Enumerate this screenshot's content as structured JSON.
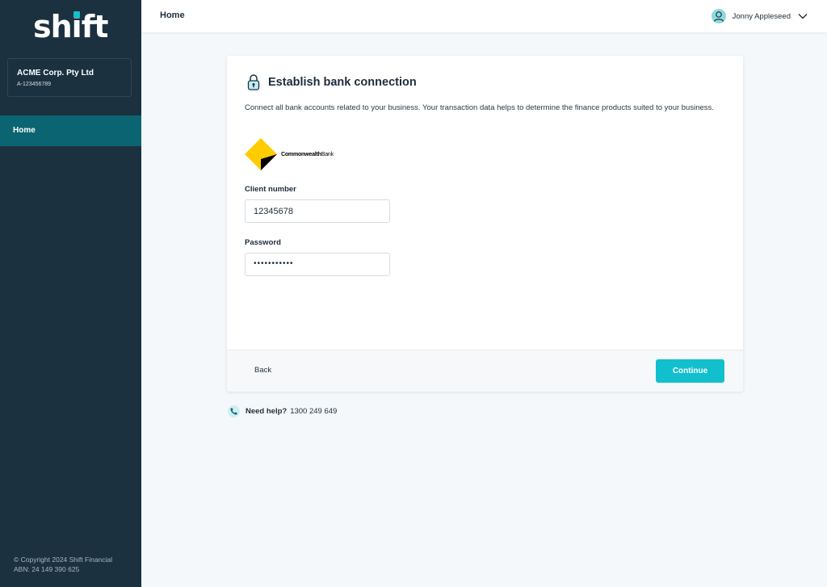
{
  "app": {
    "logo_text_before": "sh",
    "logo_text_i": "i",
    "logo_text_after": "ft",
    "accent_color": "#12bfcd"
  },
  "sidebar": {
    "org_name": "ACME Corp. Pty Ltd",
    "org_id": "A-123456789",
    "nav": [
      {
        "label": "Home",
        "active": true
      }
    ],
    "copyright": "© Copyright 2024 Shift Financial",
    "abn": "ABN: 24 149 390 625"
  },
  "topbar": {
    "title": "Home",
    "user_name": "Jonny Appleseed",
    "user_icon": "user-icon",
    "menu_icon": "chevron-down-icon"
  },
  "card": {
    "icon": "lock-icon",
    "title": "Establish bank connection",
    "description": "Connect all bank accounts related to your business. Your transaction data helps to determine the finance products suited to your business.",
    "bank": {
      "name_bold": "Commonwealth",
      "name_regular": "Bank"
    },
    "client_number_label": "Client number",
    "client_number_value": "12345678",
    "password_label": "Password",
    "password_value": "•••••••••••",
    "back_label": "Back",
    "continue_label": "Continue"
  },
  "help": {
    "icon": "phone-icon",
    "label": "Need help?",
    "phone": "1300 249 649"
  }
}
